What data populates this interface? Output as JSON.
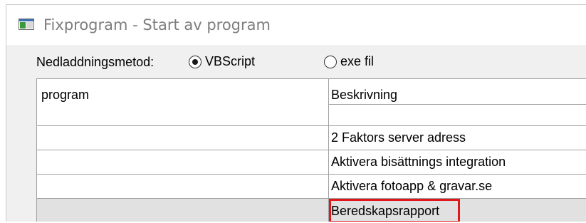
{
  "window": {
    "title": "Fixprogram - Start av program",
    "icon": "application-window-icon"
  },
  "download_method": {
    "label": "Nedladdningsmetod:",
    "options": [
      {
        "label": "VBScript",
        "selected": true
      },
      {
        "label": "exe fil",
        "selected": false
      }
    ]
  },
  "grid": {
    "columns": [
      "program",
      "Beskrivning"
    ],
    "rows": [
      {
        "program": "",
        "description": ""
      },
      {
        "program": "",
        "description": "2 Faktors server adress"
      },
      {
        "program": "",
        "description": "Aktivera bisättnings integration"
      },
      {
        "program": "",
        "description": "Aktivera fotoapp & gravar.se"
      },
      {
        "program": "",
        "description": "Beredskapsrapport",
        "highlighted": true
      }
    ]
  },
  "colors": {
    "highlight": "#e0171b",
    "selected_row": "#e1e1e1"
  }
}
